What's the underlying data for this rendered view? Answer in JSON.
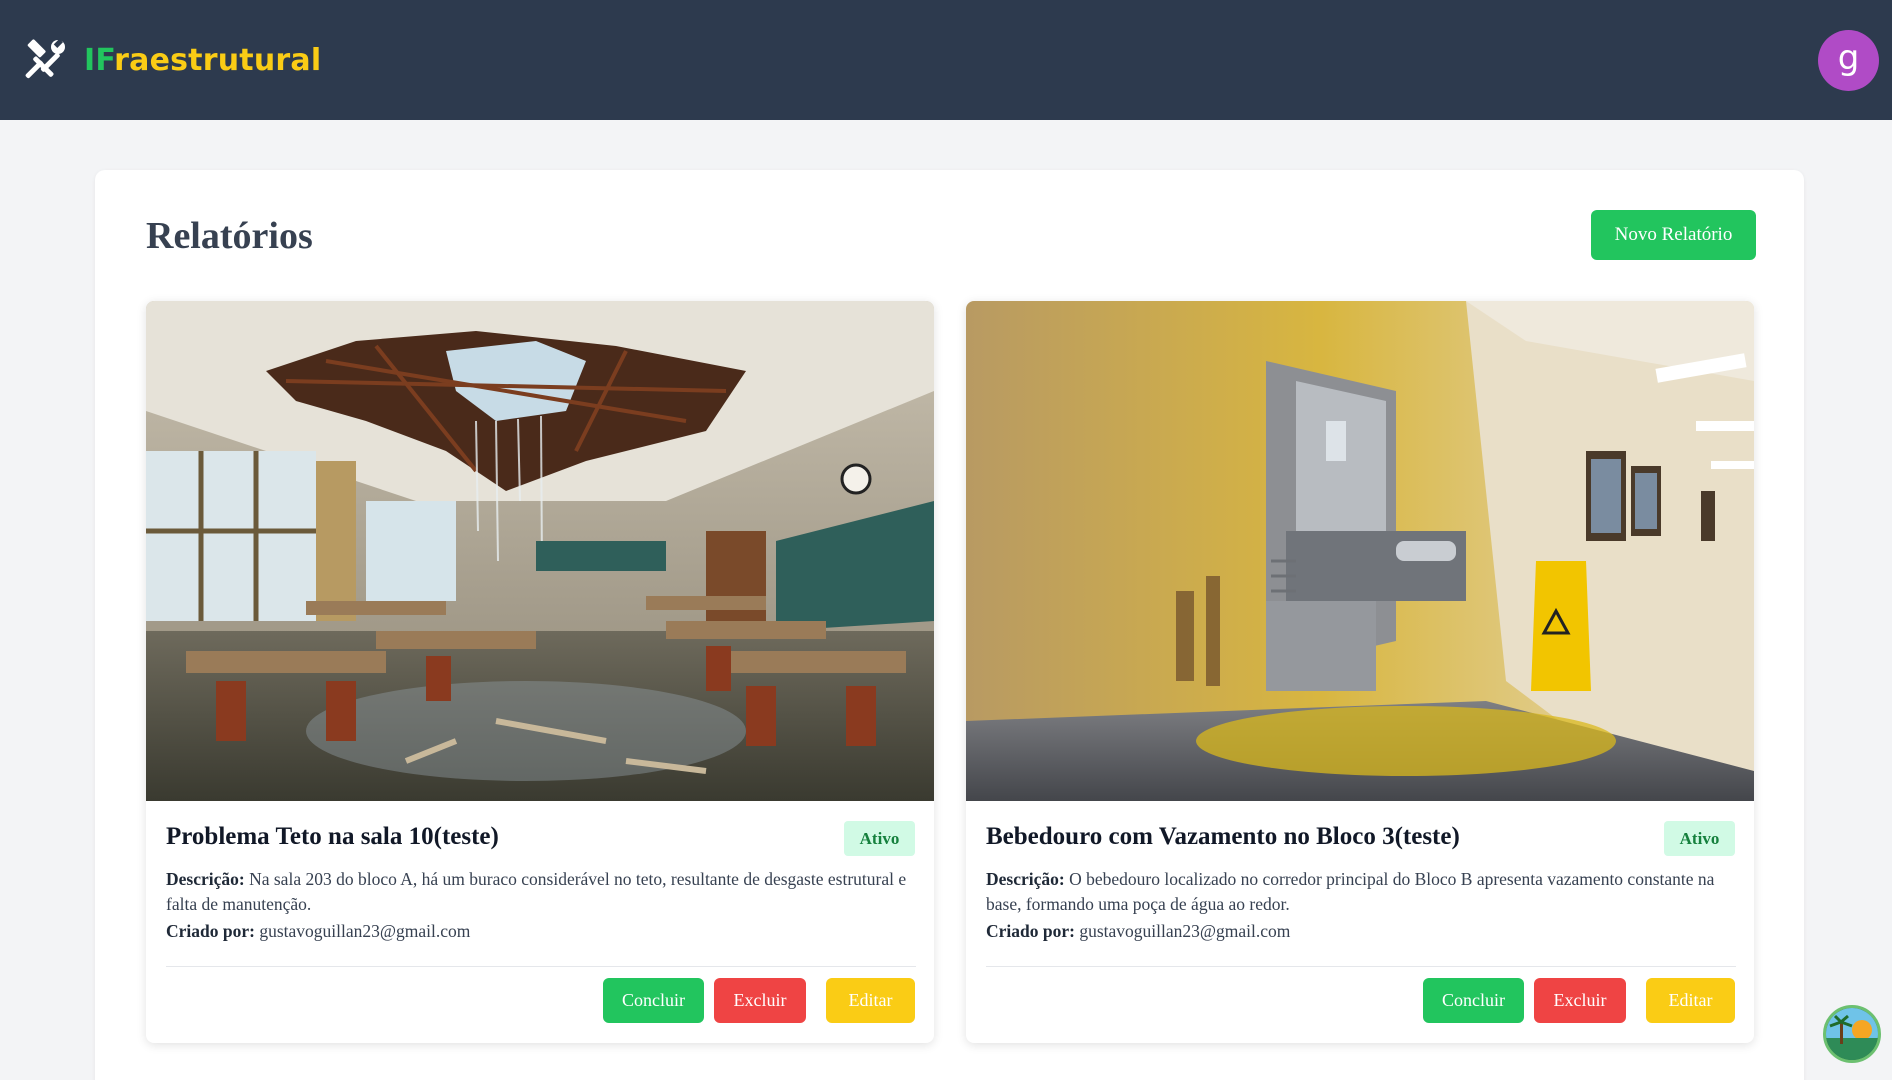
{
  "app": {
    "brand_prefix": "IF",
    "brand_suffix": "raestrutural",
    "logo_icon": "tools-icon",
    "avatar_letter": "g",
    "avatar_color": "#b04bc6"
  },
  "page": {
    "title": "Relatórios",
    "new_button_label": "Novo Relatório"
  },
  "labels": {
    "description": "Descrição:",
    "created_by": "Criado por:"
  },
  "reports": [
    {
      "title": "Problema Teto na sala 10(teste)",
      "status": "Ativo",
      "description": "Na sala 203 do bloco A, há um buraco considerável no teto, resultante de desgaste estrutural e falta de manutenção.",
      "creator": "gustavoguillan23@gmail.com",
      "image": "classroom-ceiling-damage-photo",
      "actions": {
        "complete": "Concluir",
        "delete": "Excluir",
        "edit": "Editar"
      }
    },
    {
      "title": "Bebedouro com Vazamento no Bloco 3(teste)",
      "status": "Ativo",
      "description": "O bebedouro localizado no corredor principal do Bloco B apresenta vazamento constante na base, formando uma poça de água ao redor.",
      "creator": "gustavoguillan23@gmail.com",
      "image": "water-fountain-leak-photo",
      "actions": {
        "complete": "Concluir",
        "delete": "Excluir",
        "edit": "Editar"
      }
    }
  ],
  "colors": {
    "header_bg": "#2d3a4e",
    "brand_green": "#22c55e",
    "brand_yellow": "#facc15",
    "danger": "#ef4444",
    "badge_bg": "#d1fae5",
    "badge_text": "#15803d"
  }
}
